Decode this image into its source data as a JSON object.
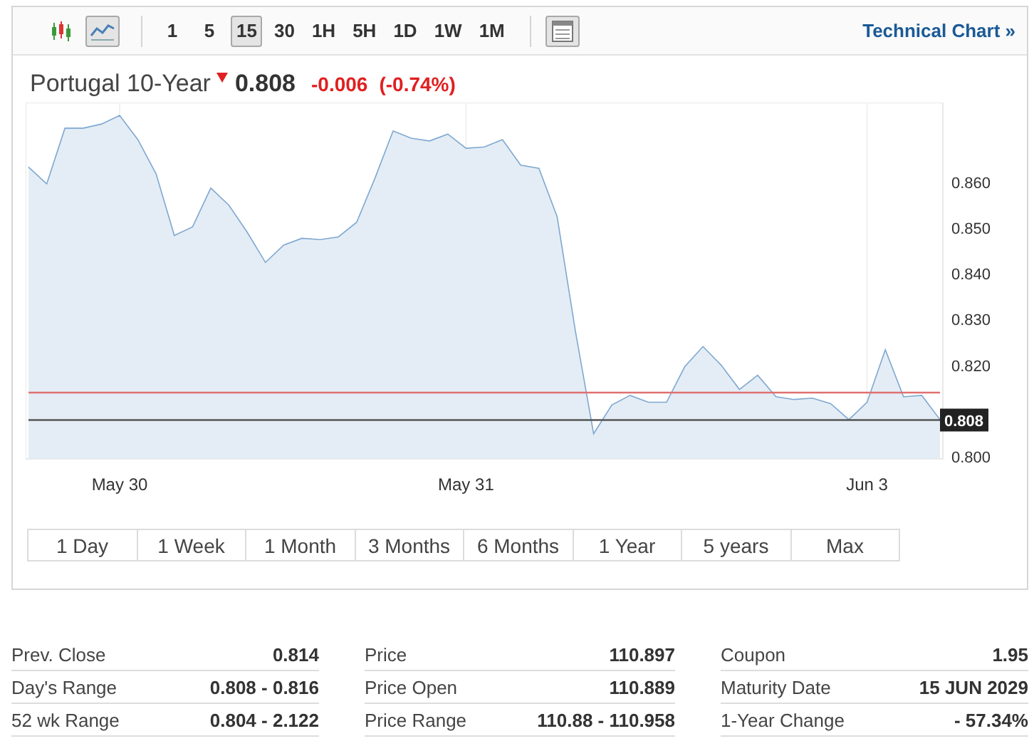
{
  "toolbar": {
    "chart_types": [
      {
        "kind": "candlestick",
        "selected": false
      },
      {
        "kind": "line",
        "selected": true
      }
    ],
    "intervals": [
      {
        "label": "1",
        "selected": false
      },
      {
        "label": "5",
        "selected": false
      },
      {
        "label": "15",
        "selected": true
      },
      {
        "label": "30",
        "selected": false
      },
      {
        "label": "1H",
        "selected": false
      },
      {
        "label": "5H",
        "selected": false
      },
      {
        "label": "1D",
        "selected": false
      },
      {
        "label": "1W",
        "selected": false
      },
      {
        "label": "1M",
        "selected": false
      }
    ],
    "link": "Technical Chart »"
  },
  "quote": {
    "name": "Portugal 10-Year",
    "price": "0.808",
    "change": "-0.006",
    "change_percent": "(-0.74%)"
  },
  "chart_data": {
    "type": "area",
    "grid": true,
    "ylim": [
      0.7995,
      0.8775
    ],
    "yticks": [
      {
        "value": 0.8,
        "label": "0.800"
      },
      {
        "value": 0.82,
        "label": "0.820"
      },
      {
        "value": 0.83,
        "label": "0.830"
      },
      {
        "value": 0.84,
        "label": "0.840"
      },
      {
        "value": 0.85,
        "label": "0.850"
      },
      {
        "value": 0.86,
        "label": "0.860"
      }
    ],
    "categories": [
      null,
      null,
      null,
      null,
      null,
      "May 30",
      null,
      null,
      null,
      null,
      null,
      null,
      null,
      null,
      null,
      null,
      null,
      null,
      null,
      null,
      null,
      null,
      null,
      null,
      "May 31",
      null,
      null,
      null,
      null,
      null,
      null,
      null,
      null,
      null,
      null,
      null,
      null,
      null,
      null,
      null,
      null,
      null,
      null,
      null,
      null,
      null,
      "Jun 3",
      null,
      null,
      null,
      null
    ],
    "series": [
      {
        "color": "#7fa8d1",
        "values": [
          0.8634,
          0.8597,
          0.8719,
          0.8719,
          0.8728,
          0.8747,
          0.8694,
          0.8619,
          0.8484,
          0.8503,
          0.8588,
          0.855,
          0.8491,
          0.8425,
          0.8463,
          0.8478,
          0.8475,
          0.8481,
          0.8513,
          0.8609,
          0.8713,
          0.8697,
          0.8691,
          0.8706,
          0.8675,
          0.8678,
          0.8694,
          0.8638,
          0.8631,
          0.8525,
          0.8275,
          0.805,
          0.8113,
          0.8134,
          0.8119,
          0.8119,
          0.8197,
          0.8241,
          0.82,
          0.8147,
          0.8178,
          0.8131,
          0.8125,
          0.8128,
          0.8116,
          0.8081,
          0.8119,
          0.8234,
          0.8131,
          0.8134,
          0.8081
        ]
      }
    ],
    "ref_lines": [
      {
        "axis": "y",
        "value": 0.814,
        "color": "#e07070"
      },
      {
        "axis": "y",
        "value": 0.808,
        "color": "#555555"
      }
    ]
  },
  "price_marker": {
    "label": "0.808"
  },
  "ranges": [
    {
      "label": "1 Day",
      "selected": false
    },
    {
      "label": "1 Week",
      "selected": false
    },
    {
      "label": "1 Month",
      "selected": false
    },
    {
      "label": "3 Months",
      "selected": false
    },
    {
      "label": "6 Months",
      "selected": false
    },
    {
      "label": "1 Year",
      "selected": false
    },
    {
      "label": "5 years",
      "selected": false
    },
    {
      "label": "Max",
      "selected": false
    }
  ],
  "stats": [
    [
      {
        "label": "Prev. Close",
        "value": "0.814"
      },
      {
        "label": "Day's Range",
        "value": "0.808 - 0.816"
      },
      {
        "label": "52 wk Range",
        "value": "0.804 - 2.122"
      }
    ],
    [
      {
        "label": "Price",
        "value": "110.897"
      },
      {
        "label": "Price Open",
        "value": "110.889"
      },
      {
        "label": "Price Range",
        "value": "110.88 - 110.958"
      }
    ],
    [
      {
        "label": "Coupon",
        "value": "1.95"
      },
      {
        "label": "Maturity Date",
        "value": "15 JUN 2029"
      },
      {
        "label": "1-Year Change",
        "value": "- 57.34%"
      }
    ]
  ]
}
